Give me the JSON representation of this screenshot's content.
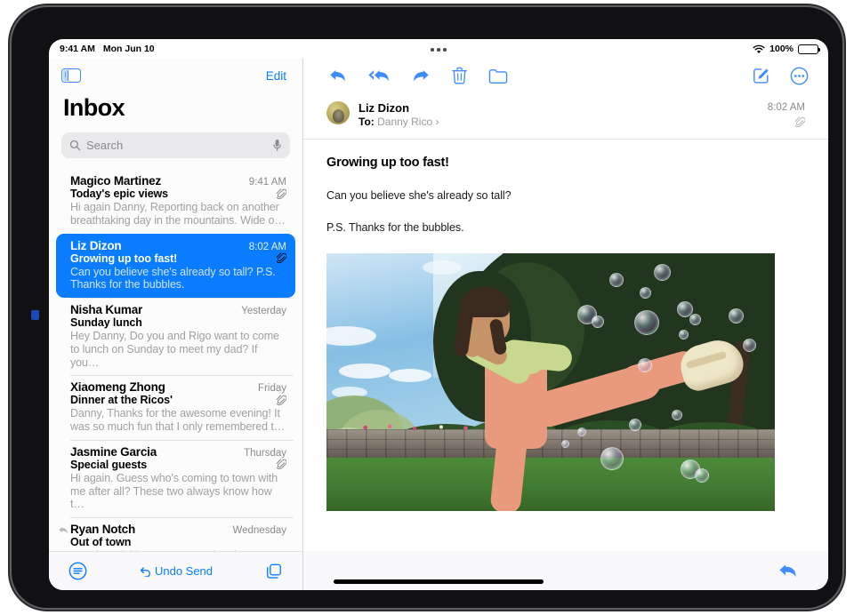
{
  "status_bar": {
    "time": "9:41 AM",
    "date": "Mon Jun 10",
    "wifi_icon": "wifi-icon",
    "battery_percent": "100%",
    "multitask_icon": "multitasking-dots-icon"
  },
  "sidebar": {
    "toggle_icon": "sidebar-toggle-icon",
    "edit_label": "Edit",
    "title": "Inbox",
    "search": {
      "placeholder": "Search",
      "search_icon": "search-icon",
      "mic_icon": "microphone-icon"
    },
    "messages": [
      {
        "sender": "Magico Martinez",
        "date": "9:41 AM",
        "subject": "Today's epic views",
        "preview": "Hi again Danny, Reporting back on another breathtaking day in the mountains. Wide o…",
        "has_attachment": true,
        "replied": false,
        "selected": false
      },
      {
        "sender": "Liz Dizon",
        "date": "8:02 AM",
        "subject": "Growing up too fast!",
        "preview": "Can you believe she's already so tall? P.S. Thanks for the bubbles.",
        "has_attachment": true,
        "replied": false,
        "selected": true
      },
      {
        "sender": "Nisha Kumar",
        "date": "Yesterday",
        "subject": "Sunday lunch",
        "preview": "Hey Danny, Do you and Rigo want to come to lunch on Sunday to meet my dad? If you…",
        "has_attachment": false,
        "replied": false,
        "selected": false
      },
      {
        "sender": "Xiaomeng Zhong",
        "date": "Friday",
        "subject": "Dinner at the Ricos'",
        "preview": "Danny, Thanks for the awesome evening! It was so much fun that I only remembered t…",
        "has_attachment": true,
        "replied": false,
        "selected": false
      },
      {
        "sender": "Jasmine Garcia",
        "date": "Thursday",
        "subject": "Special guests",
        "preview": "Hi again. Guess who's coming to town with me after all? These two always know how t…",
        "has_attachment": true,
        "replied": false,
        "selected": false
      },
      {
        "sender": "Ryan Notch",
        "date": "Wednesday",
        "subject": "Out of town",
        "preview": "Howdy, neighbor, Just wanted to drop a quick note to let you know we're leaving T…",
        "has_attachment": false,
        "replied": true,
        "selected": false
      }
    ],
    "toolbar": {
      "filter_icon": "filter-icon",
      "undo_send_label": "Undo Send",
      "undo_icon": "undo-arrow-icon",
      "new_window_icon": "new-window-icon"
    }
  },
  "detail": {
    "toolbar": {
      "reply_icon": "reply-icon",
      "reply_all_icon": "reply-all-icon",
      "forward_icon": "forward-icon",
      "trash_icon": "trash-icon",
      "folder_icon": "folder-icon",
      "compose_icon": "compose-icon",
      "more_icon": "more-circle-icon"
    },
    "message": {
      "avatar_name": "avatar",
      "sender": "Liz Dizon",
      "to_label": "To:",
      "to_recipient": "Danny Rico",
      "disclosure_icon": "chevron-right-icon",
      "time": "8:02 AM",
      "attachment_icon": "paperclip-icon",
      "subject": "Growing up too fast!",
      "paragraphs": [
        "Can you believe she's already so tall?",
        "P.S. Thanks for the bubbles."
      ],
      "photo_alt": "girl-kicking-with-bubbles-photo"
    },
    "bottom_toolbar": {
      "reply_icon": "reply-icon"
    }
  },
  "colors": {
    "accent_blue": "#0a7cff",
    "selected_row": "#0a7cff",
    "secondary_text": "#8a8a8e",
    "preview_text": "#a0a0a5"
  }
}
